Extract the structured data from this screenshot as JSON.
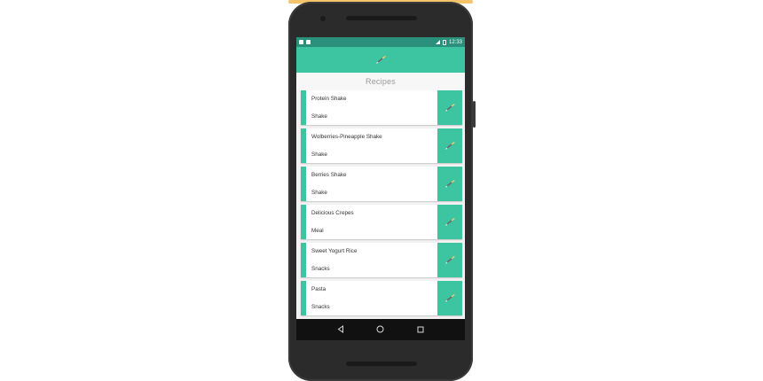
{
  "statusbar": {
    "time": "12:33"
  },
  "section_title": "Recipes",
  "recipes": [
    {
      "name": "Protein Shake",
      "category": "Shake"
    },
    {
      "name": "Wolberries-Pineapple Shake",
      "category": "Shake"
    },
    {
      "name": "Berries Shake",
      "category": "Shake"
    },
    {
      "name": "Delicious Crepes",
      "category": "Meal"
    },
    {
      "name": "Sweet Yogurt Rice",
      "category": "Snacks"
    },
    {
      "name": "Pasta",
      "category": "Snacks"
    }
  ],
  "icons": {
    "appbar": "paintbrush-icon",
    "card_action": "paintbrush-icon",
    "nav": [
      "back-icon",
      "home-icon",
      "recents-icon"
    ]
  },
  "colors": {
    "accent": "#3dc4a1",
    "statusbar": "#2a8f7b",
    "phone_body": "#2b2b2b"
  }
}
